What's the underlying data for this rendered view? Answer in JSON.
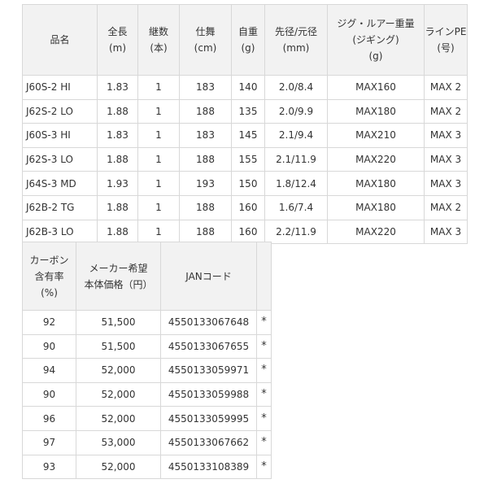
{
  "spec_table": {
    "headers": [
      [
        "品名"
      ],
      [
        "全長",
        "(m)"
      ],
      [
        "継数",
        "(本)"
      ],
      [
        "仕舞",
        "(cm)"
      ],
      [
        "自重",
        "(g)"
      ],
      [
        "先径/元径",
        "(mm)"
      ],
      [
        "ジグ・ルアー重量",
        "(ジギング)",
        "(g)"
      ],
      [
        "ラインPE",
        "(号)"
      ]
    ],
    "rows": [
      [
        "J60S-2 HI",
        "1.83",
        "1",
        "183",
        "140",
        "2.0/8.4",
        "MAX160",
        "MAX 2"
      ],
      [
        "J62S-2 LO",
        "1.88",
        "1",
        "188",
        "135",
        "2.0/9.9",
        "MAX180",
        "MAX 2"
      ],
      [
        "J60S-3 HI",
        "1.83",
        "1",
        "183",
        "145",
        "2.1/9.4",
        "MAX210",
        "MAX 3"
      ],
      [
        "J62S-3 LO",
        "1.88",
        "1",
        "188",
        "155",
        "2.1/11.9",
        "MAX220",
        "MAX 3"
      ],
      [
        "J64S-3 MD",
        "1.93",
        "1",
        "193",
        "150",
        "1.8/12.4",
        "MAX180",
        "MAX 3"
      ],
      [
        "J62B-2 TG",
        "1.88",
        "1",
        "188",
        "160",
        "1.6/7.4",
        "MAX180",
        "MAX 2"
      ],
      [
        "J62B-3 LO",
        "1.88",
        "1",
        "188",
        "160",
        "2.2/11.9",
        "MAX220",
        "MAX 3"
      ]
    ]
  },
  "price_table": {
    "headers": [
      [
        "カーボン",
        "含有率",
        "(%)"
      ],
      [
        "メーカー希望",
        "本体価格（円）"
      ],
      [
        "JANコード"
      ],
      [
        ""
      ]
    ],
    "rows": [
      [
        "92",
        "51,500",
        "4550133067648",
        "*"
      ],
      [
        "90",
        "51,500",
        "4550133067655",
        "*"
      ],
      [
        "94",
        "52,000",
        "4550133059971",
        "*"
      ],
      [
        "90",
        "52,000",
        "4550133059988",
        "*"
      ],
      [
        "96",
        "52,000",
        "4550133059995",
        "*"
      ],
      [
        "97",
        "53,000",
        "4550133067662",
        "*"
      ],
      [
        "93",
        "52,000",
        "4550133108389",
        "*"
      ]
    ]
  }
}
